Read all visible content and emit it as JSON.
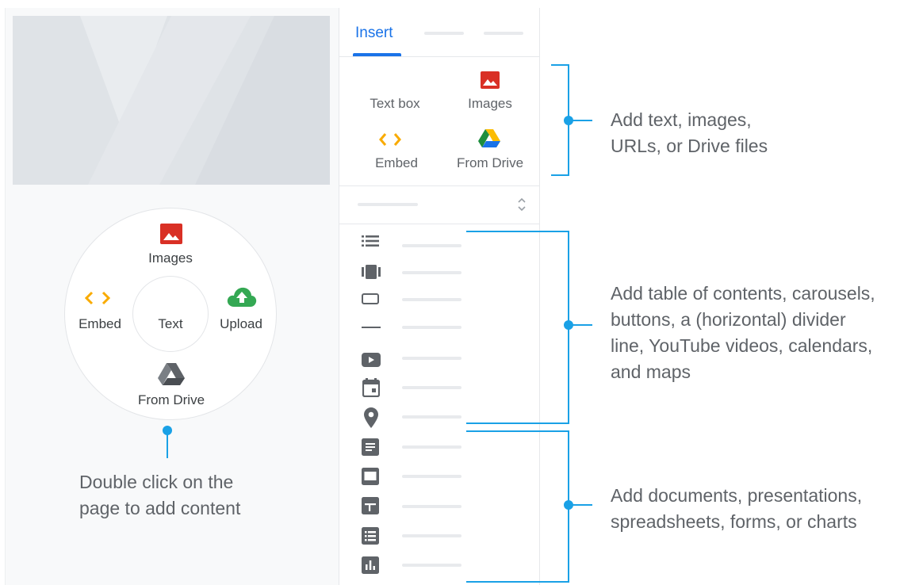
{
  "canvas": {
    "radial_menu": {
      "center_label": "Text",
      "items": [
        {
          "label": "Images",
          "icon": "image-icon"
        },
        {
          "label": "Embed",
          "icon": "embed-code-icon"
        },
        {
          "label": "Upload",
          "icon": "cloud-upload-icon"
        },
        {
          "label": "From Drive",
          "icon": "google-drive-icon"
        }
      ]
    },
    "caption": "Double click on the\npage to add content"
  },
  "panel": {
    "tab_active": "Insert",
    "insert_items": [
      {
        "label": "Text box",
        "icon": ""
      },
      {
        "label": "Images",
        "icon": "image-icon"
      },
      {
        "label": "Embed",
        "icon": "embed-code-icon"
      },
      {
        "label": "From Drive",
        "icon": "google-drive-icon"
      }
    ],
    "element_icons": [
      "table-of-contents-icon",
      "carousel-icon",
      "button-icon",
      "divider-icon",
      "youtube-icon",
      "calendar-icon",
      "map-pin-icon"
    ],
    "document_icons": [
      "docs-icon",
      "slides-icon",
      "sheets-icon",
      "forms-icon",
      "charts-icon"
    ]
  },
  "annotations": {
    "basic": "Add text, images,\nURLs, or Drive files",
    "elements": "Add table of contents, carousels,\nbuttons, a (horizontal) divider\nline, YouTube videos, calendars,\nand maps",
    "documents": " Add documents, presentations,\nspreadsheets, forms, or charts"
  },
  "colors": {
    "accent": "#1a73e8",
    "annotation_blue": "#1aa1e6",
    "image_red": "#d93025",
    "embed_yellow": "#f9ab00",
    "upload_green": "#34a853",
    "icon_gray": "#5f6368"
  }
}
